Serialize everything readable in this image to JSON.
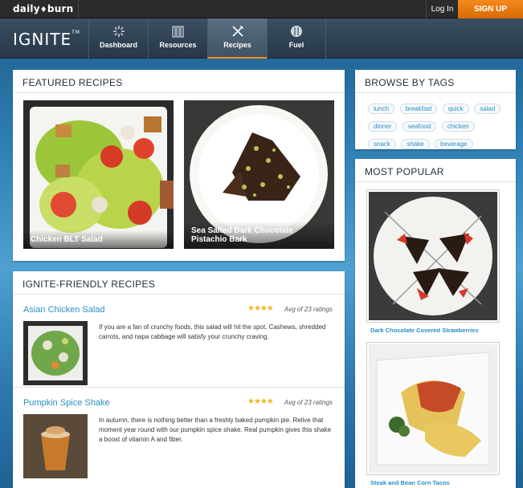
{
  "topbar": {
    "brand": "daily",
    "brand2": "burn",
    "login": "Log In",
    "signup": "SIGN UP"
  },
  "nav": {
    "logo": "IGNITE",
    "tm": "TM",
    "items": [
      {
        "label": "Dashboard",
        "icon": "sunburst-icon"
      },
      {
        "label": "Resources",
        "icon": "books-icon"
      },
      {
        "label": "Recipes",
        "icon": "utensils-icon",
        "active": true
      },
      {
        "label": "Fuel",
        "icon": "plate-icon"
      }
    ]
  },
  "featured": {
    "heading": "FEATURED RECIPES",
    "cards": [
      {
        "caption": "Chicken BLT Salad"
      },
      {
        "caption": "Sea Salted Dark Chocolate Pistachio Bark"
      }
    ]
  },
  "friendly": {
    "heading": "IGNITE-FRIENDLY RECIPES",
    "recipes": [
      {
        "title": "Asian Chicken Salad",
        "rating_text": "Avg of 23 ratings",
        "rating": 4,
        "desc": "If you are a fan of crunchy foods, this salad will hit the spot. Cashews, shredded carrots, and napa cabbage will satisfy your crunchy craving."
      },
      {
        "title": "Pumpkin Spice Shake",
        "rating_text": "Avg of 23 ratings",
        "rating": 4,
        "desc": "In autumn, there is nothing better than a freshly baked pumpkin pie. Relive that moment year round with our pumpkin spice shake. Real pumpkin gives this shake a boost of vitamin A and fiber."
      }
    ]
  },
  "tags": {
    "heading": "BROWSE BY TAGS",
    "items": [
      "lunch",
      "breakfast",
      "quick",
      "salad",
      "dinner",
      "seafood",
      "chicken",
      "snack",
      "shake",
      "beverage"
    ]
  },
  "popular": {
    "heading": "MOST POPULAR",
    "items": [
      {
        "caption": "Dark Chocolate Covered Strawberries"
      },
      {
        "caption": "Steak and Bean Corn Tacos"
      }
    ]
  },
  "colors": {
    "accent": "#f48a1d",
    "link": "#2a8fc4",
    "stars": "#f3b51b"
  }
}
